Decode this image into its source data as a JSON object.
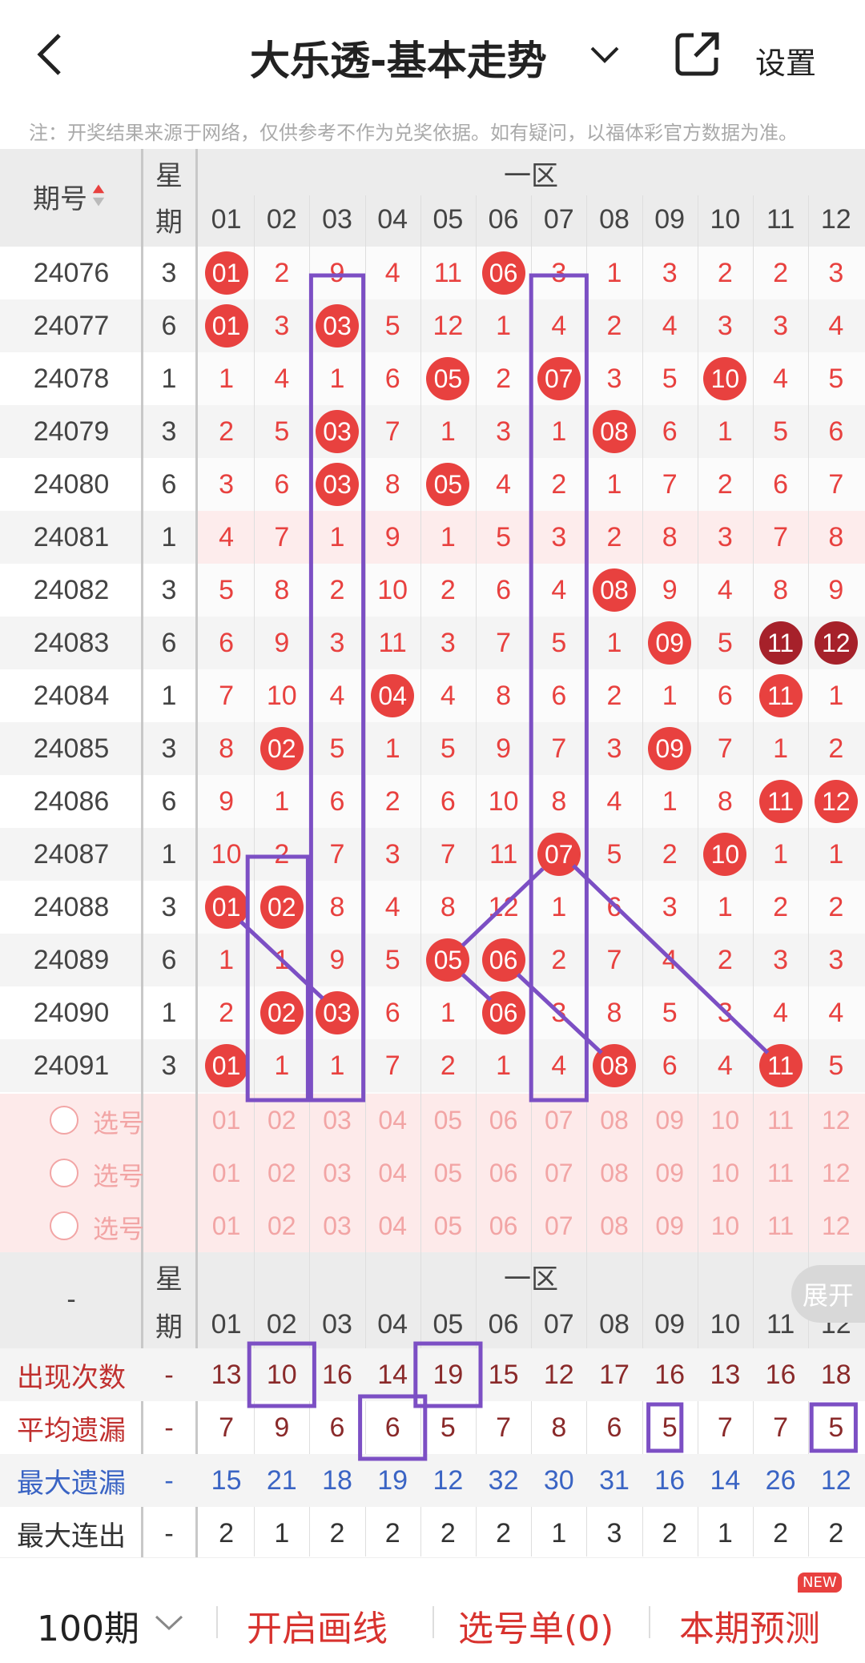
{
  "header": {
    "title": "大乐透-基本走势",
    "settings": "设置"
  },
  "notice": "注：开奖结果来源于网络，仅供参考不作为兑奖依据。如有疑问，以福体彩官方数据为准。",
  "table": {
    "period_label": "期号",
    "week_label_1": "星",
    "week_label_2": "期",
    "zone_label": "一区",
    "columns": [
      "01",
      "02",
      "03",
      "04",
      "05",
      "06",
      "07",
      "08",
      "09",
      "10",
      "11",
      "12"
    ],
    "rows": [
      {
        "p": "24076",
        "w": "3",
        "v": [
          "01",
          "2",
          "9",
          "4",
          "11",
          "06",
          "3",
          "1",
          "3",
          "2",
          "2",
          "3"
        ]
      },
      {
        "p": "24077",
        "w": "6",
        "v": [
          "01",
          "3",
          "03",
          "5",
          "12",
          "1",
          "4",
          "2",
          "4",
          "3",
          "3",
          "4"
        ]
      },
      {
        "p": "24078",
        "w": "1",
        "v": [
          "1",
          "4",
          "1",
          "6",
          "05",
          "2",
          "07",
          "3",
          "5",
          "10",
          "4",
          "5"
        ]
      },
      {
        "p": "24079",
        "w": "3",
        "v": [
          "2",
          "5",
          "03",
          "7",
          "1",
          "3",
          "1",
          "08",
          "6",
          "1",
          "5",
          "6"
        ]
      },
      {
        "p": "24080",
        "w": "6",
        "v": [
          "3",
          "6",
          "03",
          "8",
          "05",
          "4",
          "2",
          "1",
          "7",
          "2",
          "6",
          "7"
        ]
      },
      {
        "p": "24081",
        "w": "1",
        "v": [
          "4",
          "7",
          "1",
          "9",
          "1",
          "5",
          "3",
          "2",
          "8",
          "3",
          "7",
          "8"
        ]
      },
      {
        "p": "24082",
        "w": "3",
        "v": [
          "5",
          "8",
          "2",
          "10",
          "2",
          "6",
          "4",
          "08",
          "9",
          "4",
          "8",
          "9"
        ]
      },
      {
        "p": "24083",
        "w": "6",
        "v": [
          "6",
          "9",
          "3",
          "11",
          "3",
          "7",
          "5",
          "1",
          "09",
          "5",
          "11",
          "12"
        ]
      },
      {
        "p": "24084",
        "w": "1",
        "v": [
          "7",
          "10",
          "4",
          "04",
          "4",
          "8",
          "6",
          "2",
          "1",
          "6",
          "11",
          "1"
        ]
      },
      {
        "p": "24085",
        "w": "3",
        "v": [
          "8",
          "02",
          "5",
          "1",
          "5",
          "9",
          "7",
          "3",
          "09",
          "7",
          "1",
          "2"
        ]
      },
      {
        "p": "24086",
        "w": "6",
        "v": [
          "9",
          "1",
          "6",
          "2",
          "6",
          "10",
          "8",
          "4",
          "1",
          "8",
          "11",
          "12"
        ]
      },
      {
        "p": "24087",
        "w": "1",
        "v": [
          "10",
          "2",
          "7",
          "3",
          "7",
          "11",
          "07",
          "5",
          "2",
          "10",
          "1",
          "1"
        ]
      },
      {
        "p": "24088",
        "w": "3",
        "v": [
          "01",
          "02",
          "8",
          "4",
          "8",
          "12",
          "1",
          "6",
          "3",
          "1",
          "2",
          "2"
        ]
      },
      {
        "p": "24089",
        "w": "6",
        "v": [
          "1",
          "1",
          "9",
          "5",
          "05",
          "06",
          "2",
          "7",
          "4",
          "2",
          "3",
          "3"
        ]
      },
      {
        "p": "24090",
        "w": "1",
        "v": [
          "2",
          "02",
          "03",
          "6",
          "1",
          "06",
          "3",
          "8",
          "5",
          "3",
          "4",
          "4"
        ]
      },
      {
        "p": "24091",
        "w": "3",
        "v": [
          "01",
          "1",
          "1",
          "7",
          "2",
          "1",
          "4",
          "08",
          "6",
          "4",
          "11",
          "5"
        ]
      }
    ],
    "balls": [
      [
        0,
        0
      ],
      [
        0,
        5
      ],
      [
        1,
        0
      ],
      [
        1,
        2
      ],
      [
        2,
        4
      ],
      [
        2,
        6
      ],
      [
        2,
        9
      ],
      [
        3,
        2
      ],
      [
        3,
        7
      ],
      [
        4,
        2
      ],
      [
        4,
        4
      ],
      [
        6,
        7
      ],
      [
        7,
        8
      ],
      [
        8,
        3
      ],
      [
        8,
        10
      ],
      [
        9,
        1
      ],
      [
        9,
        8
      ],
      [
        10,
        10
      ],
      [
        10,
        11
      ],
      [
        11,
        6
      ],
      [
        11,
        9
      ],
      [
        12,
        0
      ],
      [
        12,
        1
      ],
      [
        13,
        4
      ],
      [
        13,
        5
      ],
      [
        14,
        1
      ],
      [
        14,
        2
      ],
      [
        14,
        5
      ],
      [
        15,
        0
      ],
      [
        15,
        7
      ],
      [
        15,
        10
      ]
    ],
    "dark_balls": [
      [
        7,
        10
      ],
      [
        7,
        11
      ]
    ],
    "pick_label": "选号"
  },
  "stats": {
    "dash": "-",
    "expand": "展开",
    "rows": [
      {
        "label": "出现次数",
        "color": "#c0302f",
        "vcolor": "#8a2a2a",
        "v": [
          "13",
          "10",
          "16",
          "14",
          "19",
          "15",
          "12",
          "17",
          "16",
          "13",
          "16",
          "18"
        ]
      },
      {
        "label": "平均遗漏",
        "color": "#c0302f",
        "vcolor": "#8a2a2a",
        "v": [
          "7",
          "9",
          "6",
          "6",
          "5",
          "7",
          "8",
          "6",
          "5",
          "7",
          "7",
          "5"
        ]
      },
      {
        "label": "最大遗漏",
        "color": "#3a64c4",
        "vcolor": "#3a64c4",
        "v": [
          "15",
          "21",
          "18",
          "19",
          "12",
          "32",
          "30",
          "31",
          "16",
          "14",
          "26",
          "12"
        ]
      },
      {
        "label": "最大连出",
        "color": "#333",
        "vcolor": "#333",
        "v": [
          "2",
          "1",
          "2",
          "2",
          "2",
          "2",
          "1",
          "3",
          "2",
          "1",
          "2",
          "2"
        ]
      }
    ]
  },
  "bottom": {
    "periods": "100期",
    "draw": "开启画线",
    "picklist": "选号单(0)",
    "predict": "本期预测",
    "new_badge": "NEW"
  }
}
